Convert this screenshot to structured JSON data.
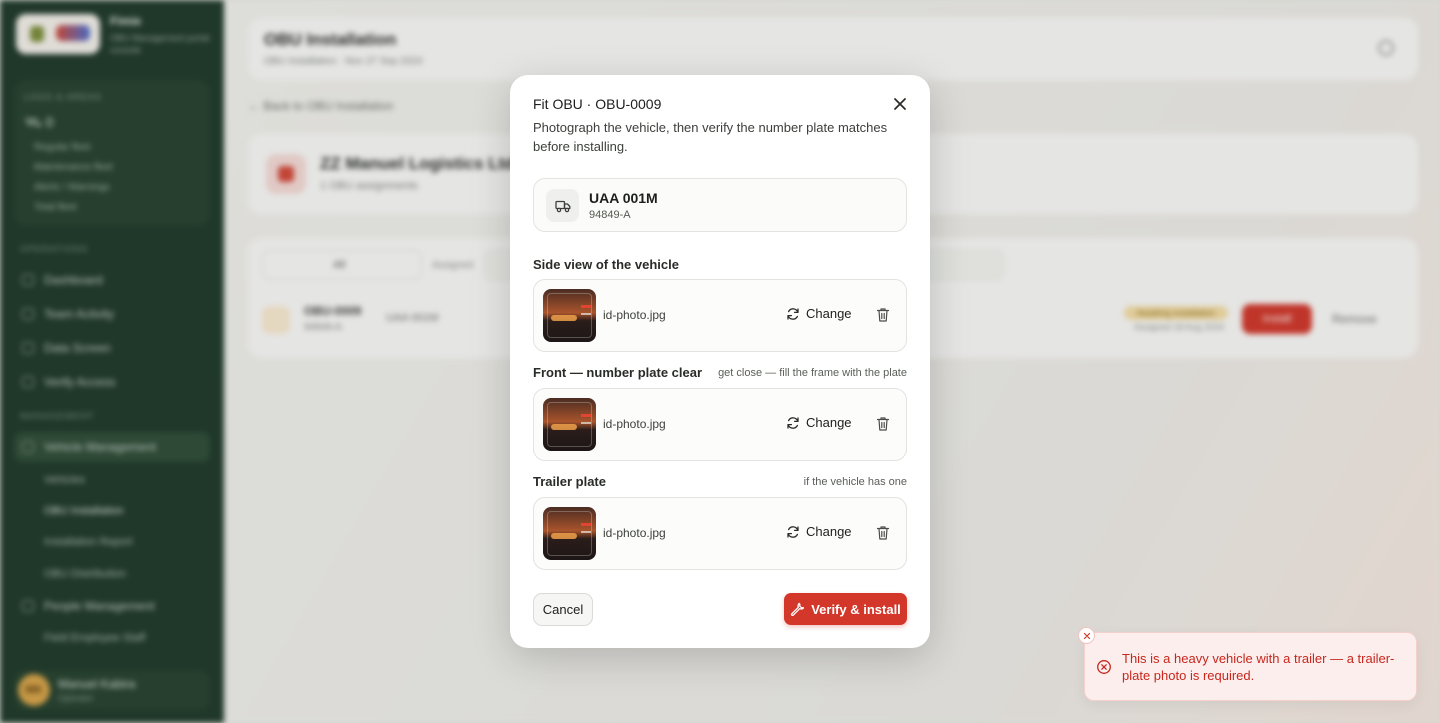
{
  "background": {
    "brand": {
      "name": "Fimie",
      "tagline": "OBU Management portal console"
    },
    "side_card": {
      "label": "LOGS & AREAS",
      "value": "🛰 0",
      "rows": [
        "Regular fleet",
        "Maintenance fleet",
        "Alerts / Warnings",
        "Total fleet"
      ]
    },
    "sections": [
      "OPERATIONS",
      "MANAGEMENT"
    ],
    "nav": [
      "Dashboard",
      "Team Activity",
      "Data Screen",
      "Verify Access",
      "Vehicle Management",
      "People Management"
    ],
    "sub_nav": [
      "Vehicles",
      "OBU Installation",
      "Installation Report",
      "OBU Distribution",
      "Field Employee Staff"
    ],
    "user": {
      "initials": "MK",
      "name": "Manuel Kabira",
      "role": "Operator"
    },
    "header": {
      "title": "OBU Installation",
      "subtitle": "OBU Installation · Nov 27 Sep 2024"
    },
    "back_link": "← Back to OBU Installation",
    "company": {
      "name": "ZZ Manuel Logistics Ltd",
      "subtitle": "1 OBU assignments"
    },
    "filter": {
      "value": "All",
      "label": "Assigned"
    },
    "row": {
      "name": "OBU-0009",
      "sub": "94849-A",
      "plate": "UAA 001M",
      "badge": "Awaiting installation",
      "badge_sub": "Assigned 18 Aug 2024",
      "install": "Install",
      "remove": "Remove"
    }
  },
  "modal": {
    "title": "Fit OBU · OBU-0009",
    "description": "Photograph the vehicle, then verify the number plate matches before installing.",
    "vehicle": {
      "plate": "UAA 001M",
      "code": "94849-A"
    },
    "sections": [
      {
        "label": "Side view of the vehicle",
        "hint": "",
        "file": "id-photo.jpg",
        "change": "Change"
      },
      {
        "label": "Front — number plate clear",
        "hint": "get close — fill the frame with the plate",
        "file": "id-photo.jpg",
        "change": "Change"
      },
      {
        "label": "Trailer plate",
        "hint": "if the vehicle has one",
        "file": "id-photo.jpg",
        "change": "Change"
      }
    ],
    "cancel_label": "Cancel",
    "verify_label": "Verify & install"
  },
  "toast": {
    "message": "This is a heavy vehicle with a trailer — a trailer-plate photo is required."
  },
  "colors": {
    "accent": "#d2372a",
    "sidebar": "#1f3a2a",
    "error_text": "#c7271c",
    "error_bg": "#fdeeee"
  },
  "icons": [
    "close-icon",
    "truck-icon",
    "refresh-icon",
    "trash-icon",
    "wrench-icon",
    "error-circle-icon"
  ]
}
